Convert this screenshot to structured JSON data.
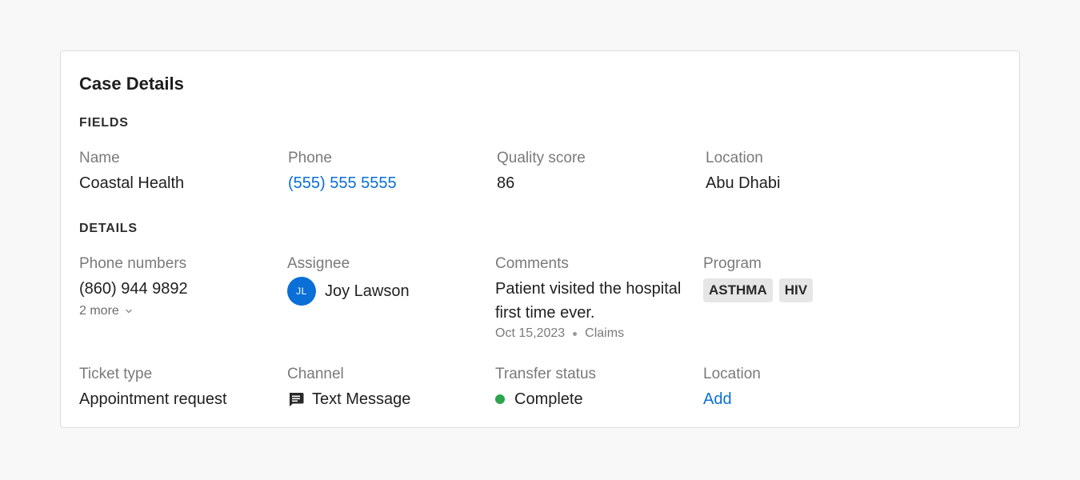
{
  "card": {
    "title": "Case Details"
  },
  "fields_section": {
    "label": "FIELDS",
    "name": {
      "label": "Name",
      "value": "Coastal Health"
    },
    "phone": {
      "label": "Phone",
      "value": "(555) 555 5555"
    },
    "quality_score": {
      "label": "Quality score",
      "value": "86"
    },
    "location": {
      "label": "Location",
      "value": "Abu Dhabi"
    }
  },
  "details_section": {
    "label": "DETAILS",
    "phone_numbers": {
      "label": "Phone numbers",
      "value": "(860) 944 9892",
      "more": "2 more"
    },
    "assignee": {
      "label": "Assignee",
      "initials": "JL",
      "name": "Joy Lawson"
    },
    "comments": {
      "label": "Comments",
      "text": "Patient visited the hospital first time ever.",
      "date": "Oct 15,2023",
      "category": "Claims"
    },
    "program": {
      "label": "Program",
      "tags": [
        "ASTHMA",
        "HIV"
      ]
    },
    "ticket_type": {
      "label": "Ticket type",
      "value": "Appointment request"
    },
    "channel": {
      "label": "Channel",
      "value": "Text Message",
      "icon": "message-icon"
    },
    "transfer_status": {
      "label": "Transfer status",
      "value": "Complete",
      "color": "#2da44e"
    },
    "location": {
      "label": "Location",
      "action": "Add"
    }
  },
  "colors": {
    "link": "#0a6fd6",
    "avatar": "#0a6fd6",
    "status_complete": "#2da44e"
  }
}
